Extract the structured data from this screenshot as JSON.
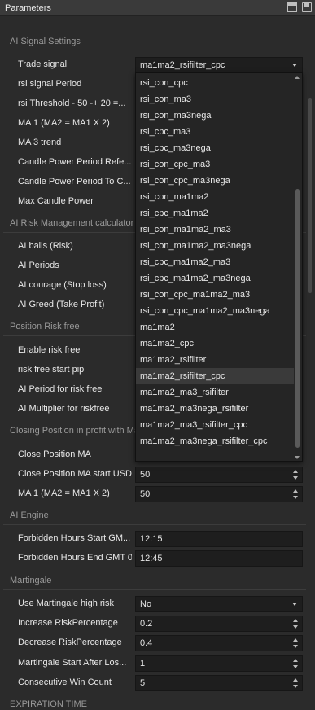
{
  "window": {
    "title": "Parameters"
  },
  "sections": {
    "ai_signal": "AI Signal Settings",
    "risk_mgmt": "AI Risk Management calculator",
    "position_risk": "Position Risk free",
    "closing": "Closing Position in profit with Ma",
    "engine": "AI Engine",
    "martingale": "Martingale",
    "expiration": "EXPIRATION TIME"
  },
  "labels": {
    "trade_signal": "Trade signal",
    "rsi_signal_period": "rsi signal Period",
    "rsi_threshold": "rsi Threshold - 50 -+ 20 =...",
    "ma1": "MA 1 (MA2 = MA1 X 2)",
    "ma3_trend": "MA 3 trend",
    "candle_power_ref": "Candle Power Period Refe...",
    "candle_power_to": "Candle Power Period To C...",
    "max_candle_power": "Max Candle Power",
    "ai_balls": "AI balls (Risk)",
    "ai_periods": "AI Periods",
    "ai_courage": "AI courage  (Stop loss)",
    "ai_greed": "AI Greed (Take Profit)",
    "enable_risk_free": "Enable risk free",
    "risk_free_start_pip": "risk free start pip",
    "ai_period_risk_free": "AI Period for risk free",
    "ai_multiplier_riskfree": "AI Multiplier for riskfree",
    "close_position_ma": "Close Position MA",
    "close_position_ma_start_usd": "Close Position MA start USD",
    "closing_ma1": "MA 1 (MA2 = MA1 X 2)",
    "forbidden_start": "Forbidden Hours Start GM...",
    "forbidden_end": "Forbidden Hours End GMT 0",
    "use_martingale": "Use Martingale high risk",
    "increase_risk": "Increase RiskPercentage",
    "decrease_risk": "Decrease RiskPercentage",
    "martingale_start_after": "Martingale Start After Los...",
    "consecutive_win": "Consecutive Win Count"
  },
  "values": {
    "trade_signal": "ma1ma2_rsifilter_cpc",
    "close_position_ma_start_usd": "50",
    "closing_ma1": "50",
    "forbidden_start": "12:15",
    "forbidden_end": "12:45",
    "use_martingale": "No",
    "increase_risk": "0.2",
    "decrease_risk": "0.4",
    "martingale_start_after": "1",
    "consecutive_win": "5"
  },
  "dropdown": {
    "selected": "ma1ma2_rsifilter_cpc",
    "options": [
      "rsi_con_cpc",
      "rsi_con_ma3",
      "rsi_con_ma3nega",
      "rsi_cpc_ma3",
      "rsi_cpc_ma3nega",
      "rsi_con_cpc_ma3",
      "rsi_con_cpc_ma3nega",
      "rsi_con_ma1ma2",
      "rsi_cpc_ma1ma2",
      "rsi_con_ma1ma2_ma3",
      "rsi_con_ma1ma2_ma3nega",
      "rsi_cpc_ma1ma2_ma3",
      "rsi_cpc_ma1ma2_ma3nega",
      "rsi_con_cpc_ma1ma2_ma3",
      "rsi_con_cpc_ma1ma2_ma3nega",
      "ma1ma2",
      "ma1ma2_cpc",
      "ma1ma2_rsifilter",
      "ma1ma2_rsifilter_cpc",
      "ma1ma2_ma3_rsifilter",
      "ma1ma2_ma3nega_rsifilter",
      "ma1ma2_ma3_rsifilter_cpc",
      "ma1ma2_ma3nega_rsifilter_cpc"
    ]
  }
}
